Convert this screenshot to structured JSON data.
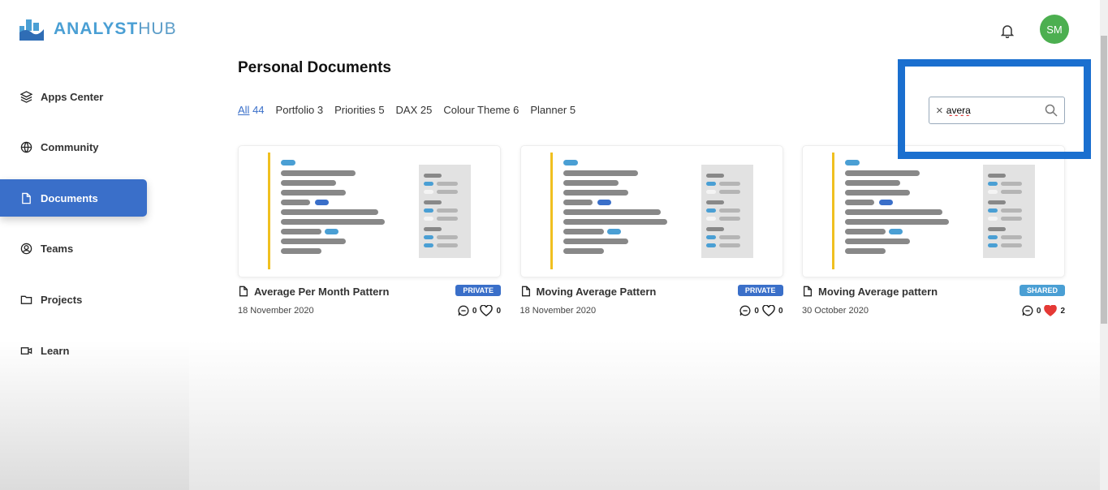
{
  "brand": {
    "name_bold": "ANALYST",
    "name_light": "HUB"
  },
  "sidebar": {
    "items": [
      {
        "label": "Apps Center",
        "icon": "layers-icon"
      },
      {
        "label": "Community",
        "icon": "globe-icon"
      },
      {
        "label": "Documents",
        "icon": "document-icon",
        "active": true
      },
      {
        "label": "Teams",
        "icon": "user-circle-icon"
      },
      {
        "label": "Projects",
        "icon": "folder-icon"
      },
      {
        "label": "Learn",
        "icon": "video-icon"
      }
    ]
  },
  "header": {
    "avatar_initials": "SM",
    "avatar_color": "#4caf50"
  },
  "main": {
    "title": "Personal Documents",
    "tabs": [
      {
        "label": "All",
        "count": "44",
        "active": true
      },
      {
        "label": "Portfolio",
        "count": "3"
      },
      {
        "label": "Priorities",
        "count": "5"
      },
      {
        "label": "DAX",
        "count": "25"
      },
      {
        "label": "Colour Theme",
        "count": "6"
      },
      {
        "label": "Planner",
        "count": "5"
      }
    ],
    "search": {
      "value": "avera"
    },
    "documents": [
      {
        "title": "Average Per Month Pattern",
        "badge": "PRIVATE",
        "badge_color": "#3a6fc9",
        "date": "18 November 2020",
        "comments": "0",
        "likes": "0",
        "liked": false
      },
      {
        "title": "Moving Average Pattern",
        "badge": "PRIVATE",
        "badge_color": "#3a6fc9",
        "date": "18 November 2020",
        "comments": "0",
        "likes": "0",
        "liked": false
      },
      {
        "title": "Moving Average pattern",
        "badge": "SHARED",
        "badge_color": "#4a9fd4",
        "date": "30 October 2020",
        "comments": "0",
        "likes": "2",
        "liked": true
      }
    ]
  }
}
